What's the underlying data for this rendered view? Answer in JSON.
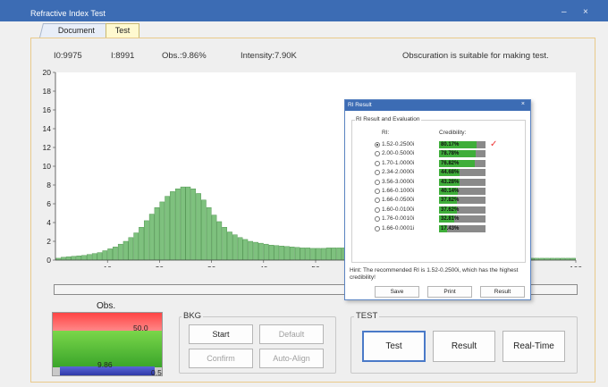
{
  "window": {
    "title": "Refractive Index Test",
    "min_glyph": "–",
    "close_glyph": "×"
  },
  "tabs": [
    {
      "label": "Document"
    },
    {
      "label": "Test"
    }
  ],
  "stats": {
    "i0": "I0:9975",
    "i": "I:8991",
    "obs": "Obs.:9.86%",
    "intensity": "Intensity:7.90K",
    "message": "Obscuration is suitable for making test."
  },
  "chart_data": {
    "type": "bar",
    "xlim": [
      0,
      100
    ],
    "ylim": [
      0,
      20
    ],
    "xticks": [
      10,
      20,
      30,
      40,
      50,
      100
    ],
    "yticks": [
      0,
      2,
      4,
      6,
      8,
      10,
      12,
      14,
      16,
      18,
      20
    ],
    "grid": false,
    "bar_color": "#7ec17e",
    "x": [
      1,
      2,
      3,
      4,
      5,
      6,
      7,
      8,
      9,
      10,
      11,
      12,
      13,
      14,
      15,
      16,
      17,
      18,
      19,
      20,
      21,
      22,
      23,
      24,
      25,
      26,
      27,
      28,
      29,
      30,
      31,
      32,
      33,
      34,
      35,
      36,
      37,
      38,
      39,
      40,
      41,
      42,
      43,
      44,
      45,
      46,
      47,
      48,
      49,
      50,
      51,
      52,
      53,
      54,
      55,
      56,
      57,
      58,
      59,
      60,
      61,
      62,
      63,
      64,
      65,
      66,
      67,
      68,
      69,
      70,
      71,
      72,
      73,
      74,
      75,
      76,
      77,
      78,
      79,
      80,
      81,
      82,
      83,
      84,
      85,
      86,
      87,
      88,
      89,
      90,
      91,
      92,
      93,
      94,
      95,
      96,
      97,
      98,
      99,
      100
    ],
    "values": [
      0.2,
      0.3,
      0.35,
      0.4,
      0.45,
      0.5,
      0.6,
      0.7,
      0.8,
      1.0,
      1.2,
      1.4,
      1.7,
      2.0,
      2.4,
      2.9,
      3.5,
      4.2,
      4.9,
      5.6,
      6.2,
      6.8,
      7.3,
      7.6,
      7.8,
      7.8,
      7.6,
      7.1,
      6.4,
      5.6,
      4.8,
      4.1,
      3.5,
      3.0,
      2.7,
      2.4,
      2.2,
      2.0,
      1.9,
      1.8,
      1.7,
      1.6,
      1.55,
      1.5,
      1.45,
      1.4,
      1.35,
      1.3,
      1.3,
      1.25,
      1.25,
      1.25,
      1.3,
      1.3,
      1.3,
      1.3,
      1.25,
      1.2,
      1.1,
      1.0,
      0.9,
      0.8,
      0.7,
      0.6,
      0.5,
      0.4,
      0.35,
      0.3,
      0.25,
      0.2,
      0.2,
      0.2,
      0.2,
      0.2,
      0.2,
      0.2,
      0.2,
      0.2,
      0.2,
      0.2,
      0.2,
      0.2,
      0.2,
      0.2,
      0.2,
      0.2,
      0.2,
      0.2,
      0.2,
      0.2,
      0.2,
      0.2,
      0.2,
      0.2,
      0.2,
      0.2,
      0.2,
      0.2,
      0.2,
      0.2
    ]
  },
  "obs_panel": {
    "title": "Obs.",
    "value": "9.86",
    "max_label": "50.0",
    "min_label": "0.5",
    "red": "#f44444",
    "green": "#4cb83a",
    "blue": "#3a46c0"
  },
  "bkg": {
    "label": "BKG",
    "start": "Start",
    "default": "Default",
    "confirm": "Confirm",
    "auto_align": "Auto-Align"
  },
  "test_group": {
    "label": "TEST",
    "test": "Test",
    "result": "Result",
    "realtime": "Real-Time"
  },
  "dialog": {
    "title": "RI Result",
    "close_glyph": "×",
    "group_label": "RI Result and Evaluation",
    "ri_header": "RI:",
    "cred_header": "Credibility:",
    "rows": [
      {
        "ri": "1.52-0.2500i",
        "cred": "80.17%",
        "value": 80.17,
        "selected": true
      },
      {
        "ri": "2.00-0.5000i",
        "cred": "78.78%",
        "value": 78.78,
        "selected": false
      },
      {
        "ri": "1.70-1.0000i",
        "cred": "76.82%",
        "value": 76.82,
        "selected": false
      },
      {
        "ri": "2.34-2.0000i",
        "cred": "44.68%",
        "value": 44.68,
        "selected": false
      },
      {
        "ri": "3.56-3.0000i",
        "cred": "43.28%",
        "value": 43.28,
        "selected": false
      },
      {
        "ri": "1.66-0.1000i",
        "cred": "40.14%",
        "value": 40.14,
        "selected": false
      },
      {
        "ri": "1.66-0.0500i",
        "cred": "37.82%",
        "value": 37.82,
        "selected": false
      },
      {
        "ri": "1.60-0.0100i",
        "cred": "37.62%",
        "value": 37.62,
        "selected": false
      },
      {
        "ri": "1.76-0.0010i",
        "cred": "32.81%",
        "value": 32.81,
        "selected": false
      },
      {
        "ri": "1.66-0.0001i",
        "cred": "17.43%",
        "value": 17.43,
        "selected": false
      }
    ],
    "check_glyph": "✓",
    "hint": "Hint: The recommended RI is 1.52-0.2500i, which has the highest credibility!",
    "save": "Save",
    "print": "Print",
    "result": "Result"
  }
}
